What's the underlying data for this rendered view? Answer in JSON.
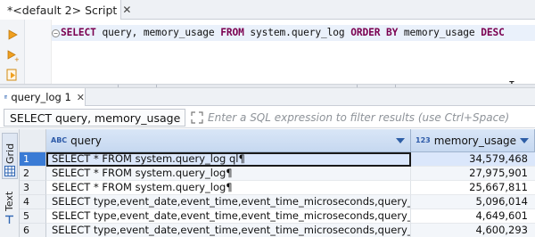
{
  "editor_tab": {
    "title": "*<default 2> Script",
    "close": "✕"
  },
  "editor": {
    "sql_tokens": [
      {
        "t": "SELECT",
        "kw": true
      },
      {
        "t": " query, memory_usage ",
        "kw": false
      },
      {
        "t": "FROM",
        "kw": true
      },
      {
        "t": " system.query_log ",
        "kw": false
      },
      {
        "t": "ORDER BY",
        "kw": true
      },
      {
        "t": " memory_usage ",
        "kw": false
      },
      {
        "t": "DESC",
        "kw": true
      }
    ],
    "fold_marker": "−"
  },
  "results_tab": {
    "title": "query_log 1",
    "close": "✕"
  },
  "filter": {
    "query_text": "SELECT query, memory_usage FR(",
    "placeholder": "Enter a SQL expression to filter results (use Ctrl+Space)"
  },
  "side_tabs": {
    "grid": "Grid",
    "text": "Text"
  },
  "grid": {
    "columns": [
      {
        "name": "query",
        "type_badge": "ABC"
      },
      {
        "name": "memory_usage",
        "type_badge": "123"
      }
    ],
    "rows": [
      {
        "n": "1",
        "query": "SELECT * FROM system.query_log ql¶",
        "memory_usage": "34,579,468"
      },
      {
        "n": "2",
        "query": "SELECT * FROM system.query_log¶",
        "memory_usage": "27,975,901"
      },
      {
        "n": "3",
        "query": "SELECT * FROM system.query_log¶",
        "memory_usage": "25,667,811"
      },
      {
        "n": "4",
        "query": "SELECT type,event_date,event_time,event_time_microseconds,query_start_time,query_s",
        "memory_usage": "5,096,014"
      },
      {
        "n": "5",
        "query": "SELECT type,event_date,event_time,event_time_microseconds,query_start_time,query_s",
        "memory_usage": "4,649,601"
      },
      {
        "n": "6",
        "query": "SELECT type,event_date,event_time,event_time_microseconds,query_start_time,query_s",
        "memory_usage": "4,600,293"
      }
    ],
    "selected_row": 0
  },
  "colors": {
    "keyword": "#7a0050",
    "header_accent": "#2e5ea6",
    "selection": "#3a7bd5"
  }
}
